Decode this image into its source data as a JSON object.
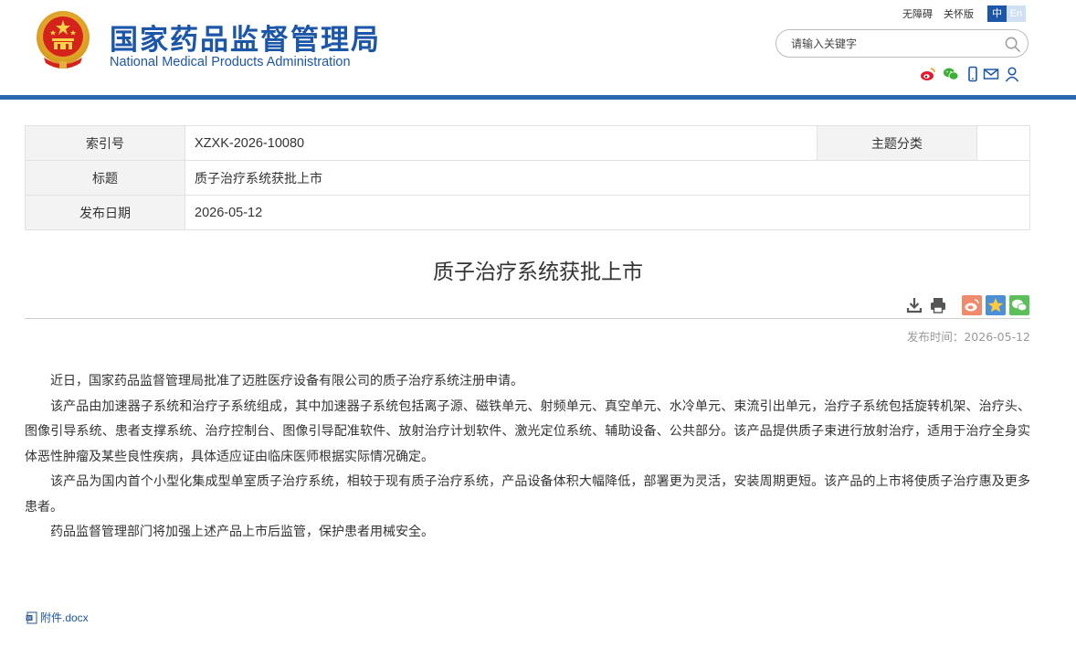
{
  "header": {
    "title_cn": "国家药品监督管理局",
    "title_en": "National Medical Products Administration",
    "links": [
      "无障碍",
      "关怀版"
    ],
    "lang_cn": "中",
    "lang_en": "En",
    "search_placeholder": "请输入关键字",
    "social": [
      "weibo-icon",
      "wechat-icon",
      "mobile-icon",
      "mail-icon",
      "user-icon"
    ],
    "accent_color": "#1c56a8"
  },
  "info": {
    "index_label": "索引号",
    "index_value": "XZXK-2026-10080",
    "category_label": "主题分类",
    "category_value": "",
    "title_label": "标题",
    "title_value": "质子治疗系统获批上市",
    "date_label": "发布日期",
    "date_value": "2026-05-12"
  },
  "article": {
    "title": "质子治疗系统获批上市",
    "tools": [
      "download-icon",
      "print-icon",
      "share-weibo-icon",
      "share-qzone-icon",
      "share-wechat-icon"
    ],
    "pub_time": "发布时间：2026-05-12",
    "paragraphs": [
      "近日，国家药品监督管理局批准了迈胜医疗设备有限公司的质子治疗系统注册申请。",
      "该产品由加速器子系统和治疗子系统组成，其中加速器子系统包括离子源、磁铁单元、射频单元、真空单元、水冷单元、束流引出单元，治疗子系统包括旋转机架、治疗头、图像引导系统、患者支撑系统、治疗控制台、图像引导配准软件、放射治疗计划软件、激光定位系统、辅助设备、公共部分。该产品提供质子束进行放射治疗，适用于治疗全身实体恶性肿瘤及某些良性疾病，具体适应证由临床医师根据实际情况确定。",
      "该产品为国内首个小型化集成型单室质子治疗系统，相较于现有质子治疗系统，产品设备体积大幅降低，部署更为灵活，安装周期更短。该产品的上市将使质子治疗惠及更多患者。",
      "药品监督管理部门将加强上述产品上市后监管，保护患者用械安全。"
    ],
    "attachment": "附件.docx"
  }
}
